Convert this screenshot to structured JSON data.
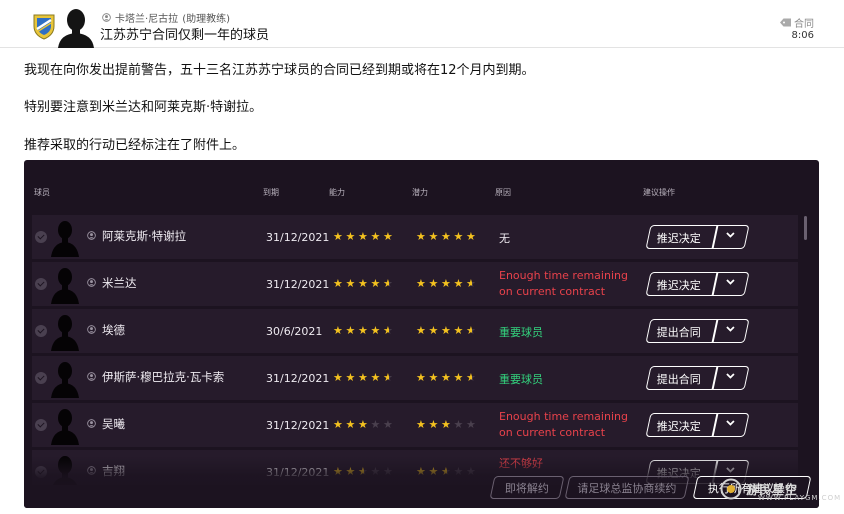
{
  "header": {
    "sender_name": "卡塔兰·尼古拉",
    "sender_role": "(助理教练)",
    "subject": "江苏苏宁合同仅剩一年的球员",
    "tag": "合同",
    "time": "8:06"
  },
  "body": {
    "para1": "我现在向你发出提前警告，五十三名江苏苏宁球员的合同已经到期或将在12个月内到期。",
    "para2": "特别要注意到米兰达和阿莱克斯·特谢拉。",
    "para3": "推荐采取的行动已经标注在了附件上。"
  },
  "table": {
    "headers": {
      "player": "球员",
      "expiry": "到期",
      "ability": "能力",
      "potential": "潜力",
      "reason": "原因",
      "action": "建议操作"
    },
    "rows": [
      {
        "name": "阿莱克斯·特谢拉",
        "date": "31/12/2021",
        "ability": 5,
        "potential": 5,
        "reason": "无",
        "reason_type": "plain",
        "action": "推迟决定"
      },
      {
        "name": "米兰达",
        "date": "31/12/2021",
        "ability": 4.5,
        "potential": 4.5,
        "reason": "Enough time remaining on current contract",
        "reason_type": "red",
        "action": "推迟决定"
      },
      {
        "name": "埃德",
        "date": "30/6/2021",
        "ability": 4.5,
        "potential": 4.5,
        "reason": "重要球员",
        "reason_type": "green",
        "action": "提出合同"
      },
      {
        "name": "伊斯萨·穆巴拉克·瓦卡索",
        "date": "31/12/2021",
        "ability": 4.5,
        "potential": 4.5,
        "reason": "重要球员",
        "reason_type": "green",
        "action": "提出合同"
      },
      {
        "name": "吴曦",
        "date": "31/12/2021",
        "ability": 3,
        "potential": 3,
        "reason": "Enough time remaining on current contract",
        "reason_type": "red",
        "action": "推迟决定"
      },
      {
        "name": "吉翔",
        "date": "31/12/2021",
        "ability": 2.5,
        "potential": 2.5,
        "reason": "还不够好",
        "reason_type": "red",
        "action": "推迟决定"
      }
    ]
  },
  "buttons": {
    "release": "即将解约",
    "ask_director": "请足球总监协商续约",
    "execute_all": "执行所有建议操作"
  },
  "watermark": {
    "text": "游民星空",
    "sub": "WWW.PLAYGM.COM"
  },
  "colors": {
    "panel_bg": "#1c1320",
    "row_bg": "#261b2b",
    "star": "#f4c21f",
    "reason_red": "#e8424b",
    "reason_green": "#33d27d"
  }
}
